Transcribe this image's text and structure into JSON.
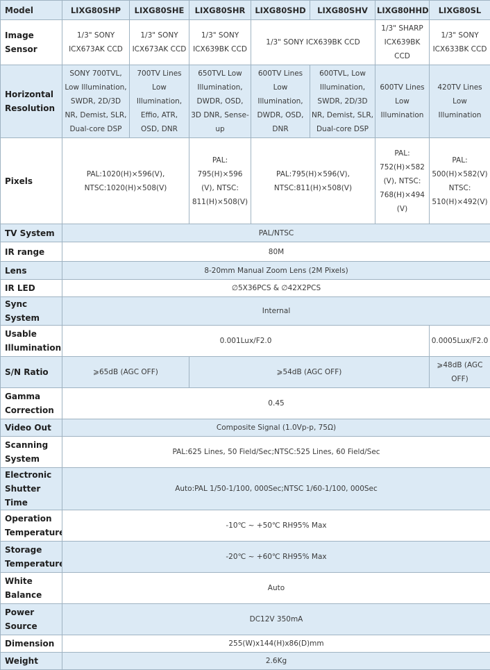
{
  "header": {
    "label": "Model",
    "models": [
      "LIXG80SHP",
      "LIXG80SHE",
      "LIXG80SHR",
      "LIXG80SHD",
      "LIXG80SHV",
      "LIXG80HHD",
      "LIXG80SL"
    ]
  },
  "image_sensor": {
    "label": "Image Sensor",
    "shp": "1/3\" SONY ICX673AK CCD",
    "she": "1/3\" SONY ICX673AK CCD",
    "shr": "1/3\" SONY ICX639BK CCD",
    "shd_shv": "1/3\" SONY ICX639BK CCD",
    "hhd": "1/3\" SHARP ICX639BK CCD",
    "sl": "1/3\" SONY ICX633BK CCD"
  },
  "horizontal_resolution": {
    "label": "Horizontal Resolution",
    "shp": "SONY 700TVL, Low Illumination, SWDR, 2D/3D NR, Demist, SLR, Dual-core DSP",
    "she": "700TV Lines Low Illumination, Effio, ATR, OSD, DNR",
    "shr": "650TVL Low Illumination, DWDR, OSD, 3D DNR, Sense-up",
    "shd": "600TV Lines Low Illumination, DWDR, OSD, DNR",
    "shv": "600TVL, Low Illumination, SWDR, 2D/3D NR, Demist, SLR, Dual-core DSP",
    "hhd": "600TV Lines Low Illumination",
    "sl": "420TV Lines Low Illumination"
  },
  "pixels": {
    "label": "Pixels",
    "shp_she": "PAL:1020(H)×596(V), NTSC:1020(H)×508(V)",
    "shr": "PAL: 795(H)×596 (V), NTSC: 811(H)×508(V)",
    "shd_shv": "PAL:795(H)×596(V), NTSC:811(H)×508(V)",
    "hhd": "PAL: 752(H)×582 (V), NTSC: 768(H)×494 (V)",
    "sl": "PAL: 500(H)×582(V) NTSC: 510(H)×492(V)"
  },
  "tv_system": {
    "label": "TV System",
    "value": "PAL/NTSC"
  },
  "ir_range": {
    "label": "IR range",
    "value": "80M"
  },
  "lens": {
    "label": "Lens",
    "value": "8-20mm Manual Zoom Lens (2M Pixels)"
  },
  "ir_led": {
    "label": "IR LED",
    "value": "∅5X36PCS & ∅42X2PCS"
  },
  "sync_system": {
    "label": "Sync System",
    "value": "Internal"
  },
  "usable_illumination": {
    "label": "Usable Illumination",
    "value": "0.001Lux/F2.0",
    "sl": "0.0005Lux/F2.0"
  },
  "sn_ratio": {
    "label": "S/N Ratio",
    "shp_she": "⩾65dB (AGC OFF)",
    "shr_hhd": "⩾54dB (AGC OFF)",
    "sl": "⩾48dB (AGC OFF)"
  },
  "gamma": {
    "label": "Gamma Correction",
    "value": "0.45"
  },
  "video_out": {
    "label": "Video Out",
    "value": "Composite Signal (1.0Vp-p, 75Ω)"
  },
  "scanning": {
    "label": "Scanning System",
    "value": "PAL:625 Lines, 50 Field/Sec;NTSC:525 Lines, 60 Field/Sec"
  },
  "shutter": {
    "label": "Electronic Shutter Time",
    "value": "Auto:PAL 1/50-1/100, 000Sec;NTSC 1/60-1/100, 000Sec"
  },
  "operation_temp": {
    "label": "Operation Temperature",
    "value": "-10℃ ~ +50℃ RH95% Max"
  },
  "storage_temp": {
    "label": "Storage Temperature",
    "value": "-20℃ ~ +60℃ RH95% Max"
  },
  "white_balance": {
    "label": "White Balance",
    "value": "Auto"
  },
  "power": {
    "label": "Power Source",
    "value": "DC12V 350mA"
  },
  "dimension": {
    "label": "Dimension",
    "value": "255(W)x144(H)x86(D)mm"
  },
  "weight": {
    "label": "Weight",
    "value": "2.6Kg"
  },
  "colors": {
    "alt_row": "#dceaf5",
    "border": "#9fb3c2",
    "text": "#3a3a3a"
  }
}
